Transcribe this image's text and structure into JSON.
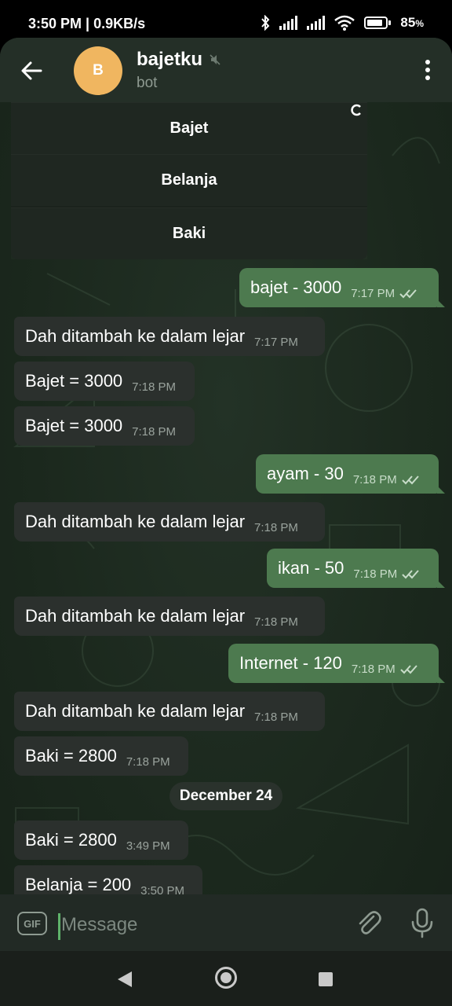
{
  "status_bar": {
    "time": "3:50 PM | 0.9KB/s",
    "battery": "85",
    "battery_suffix": "%"
  },
  "header": {
    "avatar_letter": "B",
    "title": "bajetku",
    "subtitle": "bot"
  },
  "keyboard": {
    "buttons": [
      "Bajet",
      "Belanja",
      "Baki"
    ],
    "loading_icon": "spinner-icon"
  },
  "messages": [
    {
      "dir": "out",
      "text": "bajet - 3000",
      "time": "7:17 PM"
    },
    {
      "dir": "in",
      "text": "Dah ditambah ke dalam lejar",
      "time": "7:17 PM"
    },
    {
      "dir": "in",
      "text": "Bajet = 3000",
      "time": "7:18 PM"
    },
    {
      "dir": "in",
      "text": "Bajet = 3000",
      "time": "7:18 PM"
    },
    {
      "dir": "out",
      "text": "ayam - 30",
      "time": "7:18 PM"
    },
    {
      "dir": "in",
      "text": "Dah ditambah ke dalam lejar",
      "time": "7:18 PM"
    },
    {
      "dir": "out",
      "text": "ikan - 50",
      "time": "7:18 PM"
    },
    {
      "dir": "in",
      "text": "Dah ditambah ke dalam lejar",
      "time": "7:18 PM"
    },
    {
      "dir": "out",
      "text": "Internet - 120",
      "time": "7:18 PM"
    },
    {
      "dir": "in",
      "text": "Dah ditambah ke dalam lejar",
      "time": "7:18 PM"
    },
    {
      "dir": "in",
      "text": "Baki = 2800",
      "time": "7:18 PM"
    },
    {
      "dir": "in",
      "text": "Baki = 2800",
      "time": "3:49 PM"
    },
    {
      "dir": "in",
      "text": "Belanja = 200",
      "time": "3:50 PM"
    }
  ],
  "date_separator": "December 24",
  "input": {
    "placeholder": "Message",
    "gif_label": "GIF"
  },
  "colors": {
    "outgoing": "#4d7a4f",
    "incoming": "#2b302d",
    "header": "#242f27",
    "avatar": "#f0b660",
    "accent": "#5fb36a"
  }
}
